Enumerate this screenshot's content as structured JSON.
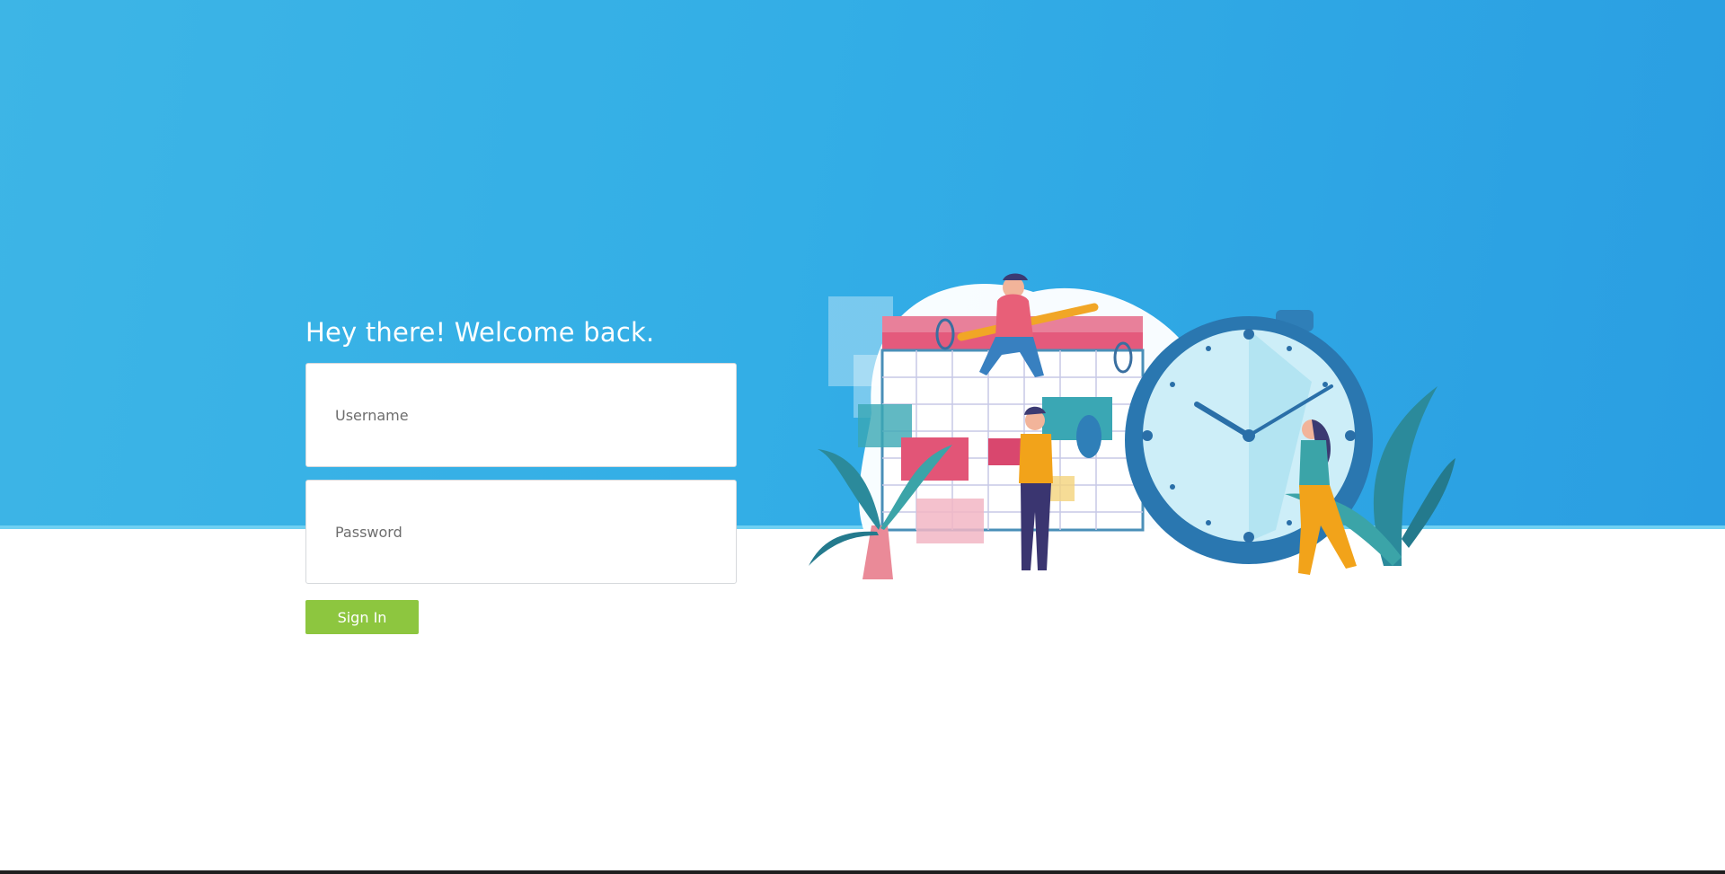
{
  "login": {
    "welcome_title": "Hey there! Welcome back.",
    "username_placeholder": "Username",
    "password_placeholder": "Password",
    "signin_label": "Sign In"
  },
  "illustration": {
    "icon": "calendar-clock-scheduling-illustration"
  },
  "colors": {
    "hero_gradient_start": "#3db5e6",
    "hero_gradient_end": "#2a9ee2",
    "signin_button": "#8dc63f",
    "title_text": "#ffffff"
  }
}
